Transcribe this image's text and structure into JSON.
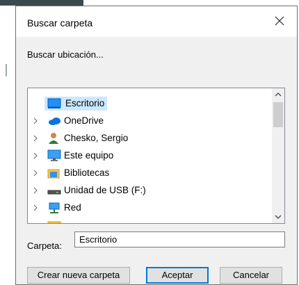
{
  "dialog": {
    "title": "Buscar carpeta",
    "prompt": "Buscar ubicación...",
    "tree": [
      {
        "label": "Escritorio",
        "icon": "desktop-icon"
      },
      {
        "label": "OneDrive",
        "icon": "cloud-icon"
      },
      {
        "label": "Chesko, Sergio",
        "icon": "user-icon"
      },
      {
        "label": "Este equipo",
        "icon": "computer-icon"
      },
      {
        "label": "Bibliotecas",
        "icon": "libraries-icon"
      },
      {
        "label": "Unidad de USB (F:)",
        "icon": "usb-drive-icon"
      },
      {
        "label": "Red",
        "icon": "network-icon"
      }
    ],
    "selected_index": 0,
    "folder_label": "Carpeta:",
    "folder_value": "Escritorio",
    "buttons": {
      "new_folder": "Crear nueva carpeta",
      "accept": "Aceptar",
      "cancel": "Cancelar"
    }
  },
  "colors": {
    "selection": "#cce8ff",
    "accent": "#0078d7"
  }
}
